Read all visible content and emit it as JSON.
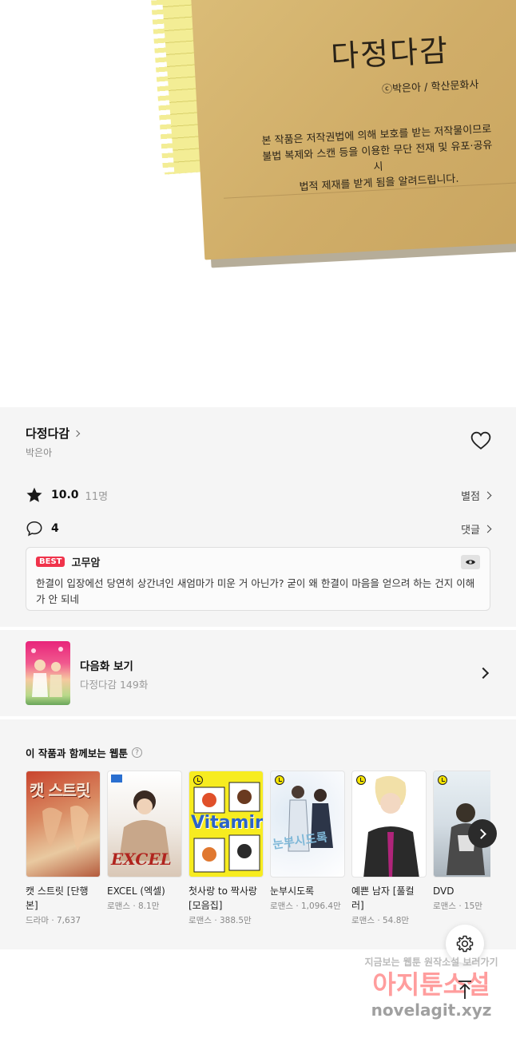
{
  "artwork": {
    "title": "다정다감",
    "copyright": "ⓒ박은아 / 학산문화사",
    "notice": "본 작품은 저작권법에 의해 보호를 받는 저작물이므로\n불법 복제와 스캔 등을 이용한 무단 전재 및 유포·공유 시\n법적 제재를 받게 됨을 알려드립니다."
  },
  "series": {
    "title": "다정다감",
    "author": "박은아"
  },
  "rating": {
    "score": "10.0",
    "count": "11명",
    "link": "별점"
  },
  "comments": {
    "count": "4",
    "link": "댓글",
    "best_badge": "BEST",
    "best_user": "고무암",
    "best_text": "한결이 입장에선 당연히 상간녀인 새엄마가 미운 거 아닌가? 굳이 왜 한결이 마음을 얻으려 하는 건지 이해가 안 되네"
  },
  "next_episode": {
    "label": "다음화 보기",
    "subtitle": "다정다감 149화"
  },
  "recommend": {
    "title": "이 작품과 함께보는 웹툰",
    "help": "?",
    "items": [
      {
        "title": "캣 스트릿 [단행본]",
        "meta": "드라마 · 7,637",
        "cover_text": "캣 스트릿"
      },
      {
        "title": "EXCEL (엑셀)",
        "meta": "로맨스 · 8.1만",
        "cover_text": "EXCEL"
      },
      {
        "title": "첫사랑 to 짝사랑 [모음집]",
        "meta": "로맨스 · 388.5만",
        "cover_text": "Vitamin"
      },
      {
        "title": "눈부시도록",
        "meta": "로맨스 · 1,096.4만",
        "cover_text": "눈부시도록"
      },
      {
        "title": "예쁜 남자 [풀컬러]",
        "meta": "로맨스 · 54.8만",
        "cover_text": ""
      },
      {
        "title": "DVD",
        "meta": "로맨스 · 15만",
        "cover_text": ""
      }
    ]
  },
  "watermark": {
    "line1": "지금보는 웹툰 원작소설 보러가기",
    "line2": "아지툰소설",
    "line3": "novelagit.xyz"
  },
  "colors": {
    "panel_bg": "#f5f5f5",
    "best_badge": "#f0334b"
  }
}
